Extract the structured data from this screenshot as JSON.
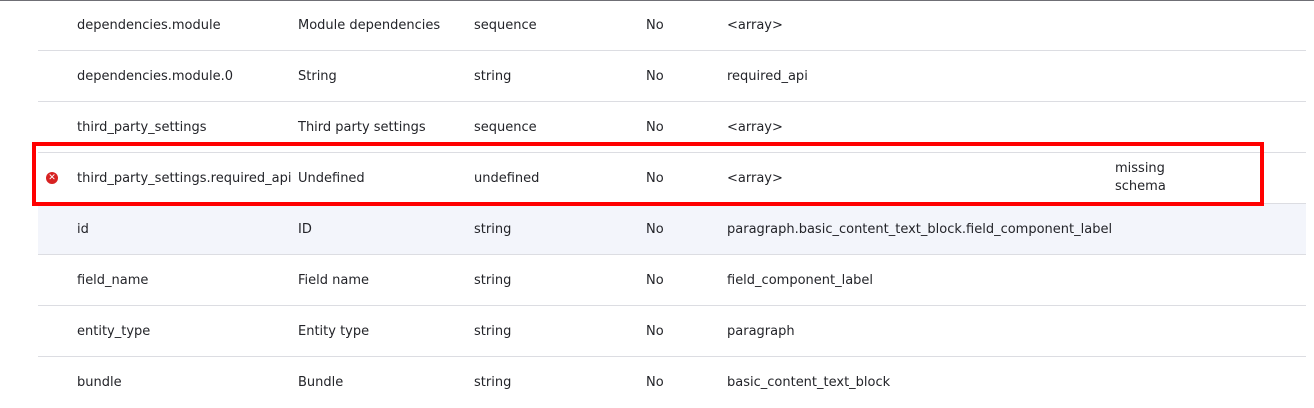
{
  "rows": [
    {
      "key": "dependencies.module",
      "label": "Module dependencies",
      "type": "sequence",
      "required": "No",
      "value": "<array>",
      "status": ""
    },
    {
      "key": "dependencies.module.0",
      "label": "String",
      "type": "string",
      "required": "No",
      "value": "required_api",
      "status": ""
    },
    {
      "key": "third_party_settings",
      "label": "Third party settings",
      "type": "sequence",
      "required": "No",
      "value": "<array>",
      "status": ""
    },
    {
      "key": "third_party_settings.required_api",
      "label": "Undefined",
      "type": "undefined",
      "required": "No",
      "value": "<array>",
      "status_line1": "missing",
      "status_line2": "schema"
    },
    {
      "key": "id",
      "label": "ID",
      "type": "string",
      "required": "No",
      "value": "paragraph.basic_content_text_block.field_component_label",
      "status": ""
    },
    {
      "key": "field_name",
      "label": "Field name",
      "type": "string",
      "required": "No",
      "value": "field_component_label",
      "status": ""
    },
    {
      "key": "entity_type",
      "label": "Entity type",
      "type": "string",
      "required": "No",
      "value": "paragraph",
      "status": ""
    },
    {
      "key": "bundle",
      "label": "Bundle",
      "type": "string",
      "required": "No",
      "value": "basic_content_text_block",
      "status": ""
    }
  ],
  "error_icon": "error-x-circle-icon",
  "colors": {
    "error": "#d72222",
    "highlight_outline": "#ff0000",
    "row_highlight_bg": "#f3f5fb",
    "row_divider": "#dcdde2"
  }
}
